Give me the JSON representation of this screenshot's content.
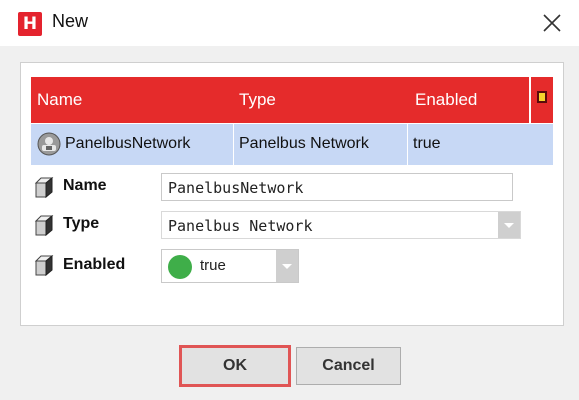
{
  "window": {
    "app_icon_letter": "H",
    "title": "New",
    "icons": {
      "app": "app-logo-icon",
      "close": "close-icon"
    },
    "accent_color": "#e52b2b"
  },
  "table": {
    "columns": [
      "Name",
      "Type",
      "Enabled"
    ],
    "column_picker_icon": "column-chooser-icon",
    "rows": [
      {
        "name": "PanelbusNetwork",
        "type": "Panelbus Network",
        "enabled": "true",
        "selected": true,
        "icon": "network-icon"
      }
    ],
    "header_color": "#e52b2b",
    "selected_row_color": "#c7d8f5"
  },
  "properties": {
    "name": {
      "label": "Name",
      "value": "PanelbusNetwork"
    },
    "type": {
      "label": "Type",
      "value": "Panelbus Network"
    },
    "enabled": {
      "label": "Enabled",
      "value": "true",
      "status_color": "#3fae49"
    }
  },
  "buttons": {
    "ok": "OK",
    "cancel": "Cancel"
  }
}
